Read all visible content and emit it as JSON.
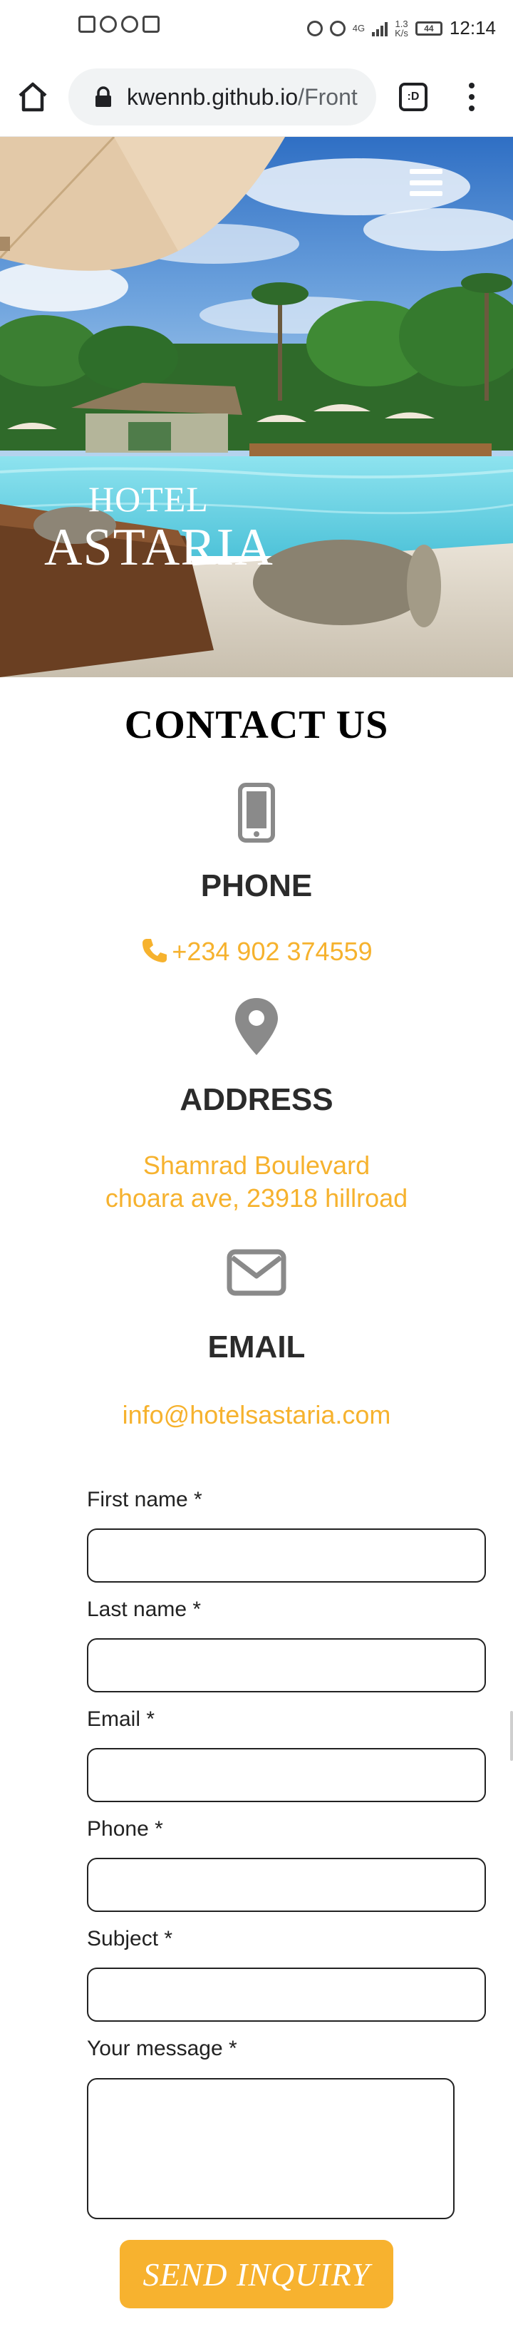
{
  "status_bar": {
    "net_speed_top": "1.3",
    "net_speed_bottom": "K/s",
    "network": "4G",
    "battery": "44",
    "time": "12:14"
  },
  "browser": {
    "url_host": "kwennb.github.io",
    "url_path": "/Front",
    "tabs_label": ":D"
  },
  "hero": {
    "logo_line1": "HOTEL",
    "logo_line2": "ASTARIA"
  },
  "contact": {
    "title": "CONTACT US",
    "phone": {
      "heading": "PHONE",
      "value": "+234 902 374559"
    },
    "address": {
      "heading": "ADDRESS",
      "line1": "Shamrad Boulevard",
      "line2": "choara ave, 23918 hillroad"
    },
    "email": {
      "heading": "EMAIL",
      "value": "info@hotelsastaria.com"
    }
  },
  "form": {
    "first_name_label": "First name *",
    "last_name_label": "Last name *",
    "email_label": "Email *",
    "phone_label": "Phone *",
    "subject_label": "Subject *",
    "message_label": "Your message *",
    "submit_label": "SEND INQUIRY"
  },
  "colors": {
    "accent": "#f6b22e",
    "button": "#f7b22f",
    "heading": "#2b2b2b",
    "icon_gray": "#8a8a8a"
  }
}
